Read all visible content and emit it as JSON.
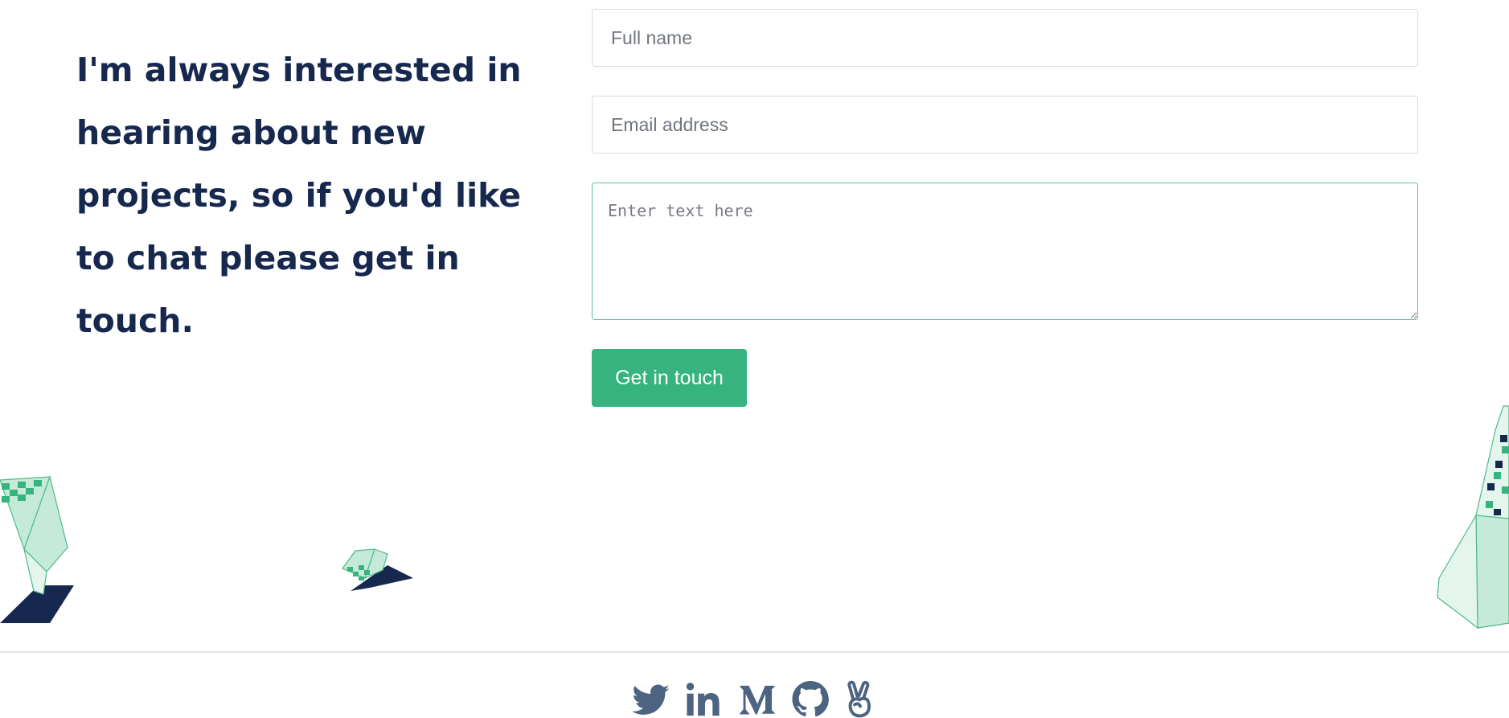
{
  "intro": {
    "text": "I'm always interested in hearing about new projects, so if you'd like to chat please get in touch."
  },
  "form": {
    "name_placeholder": "Full name",
    "email_placeholder": "Email address",
    "message_placeholder": "Enter text here",
    "submit_label": "Get in touch"
  },
  "social": {
    "icons": [
      "twitter-icon",
      "linkedin-icon",
      "medium-icon",
      "github-icon",
      "peace-hand-icon"
    ]
  },
  "colors": {
    "heading": "#17284f",
    "accent": "#36b37e",
    "accent_light": "#c6ead9",
    "navy": "#17284f",
    "icon": "#4d6382"
  }
}
